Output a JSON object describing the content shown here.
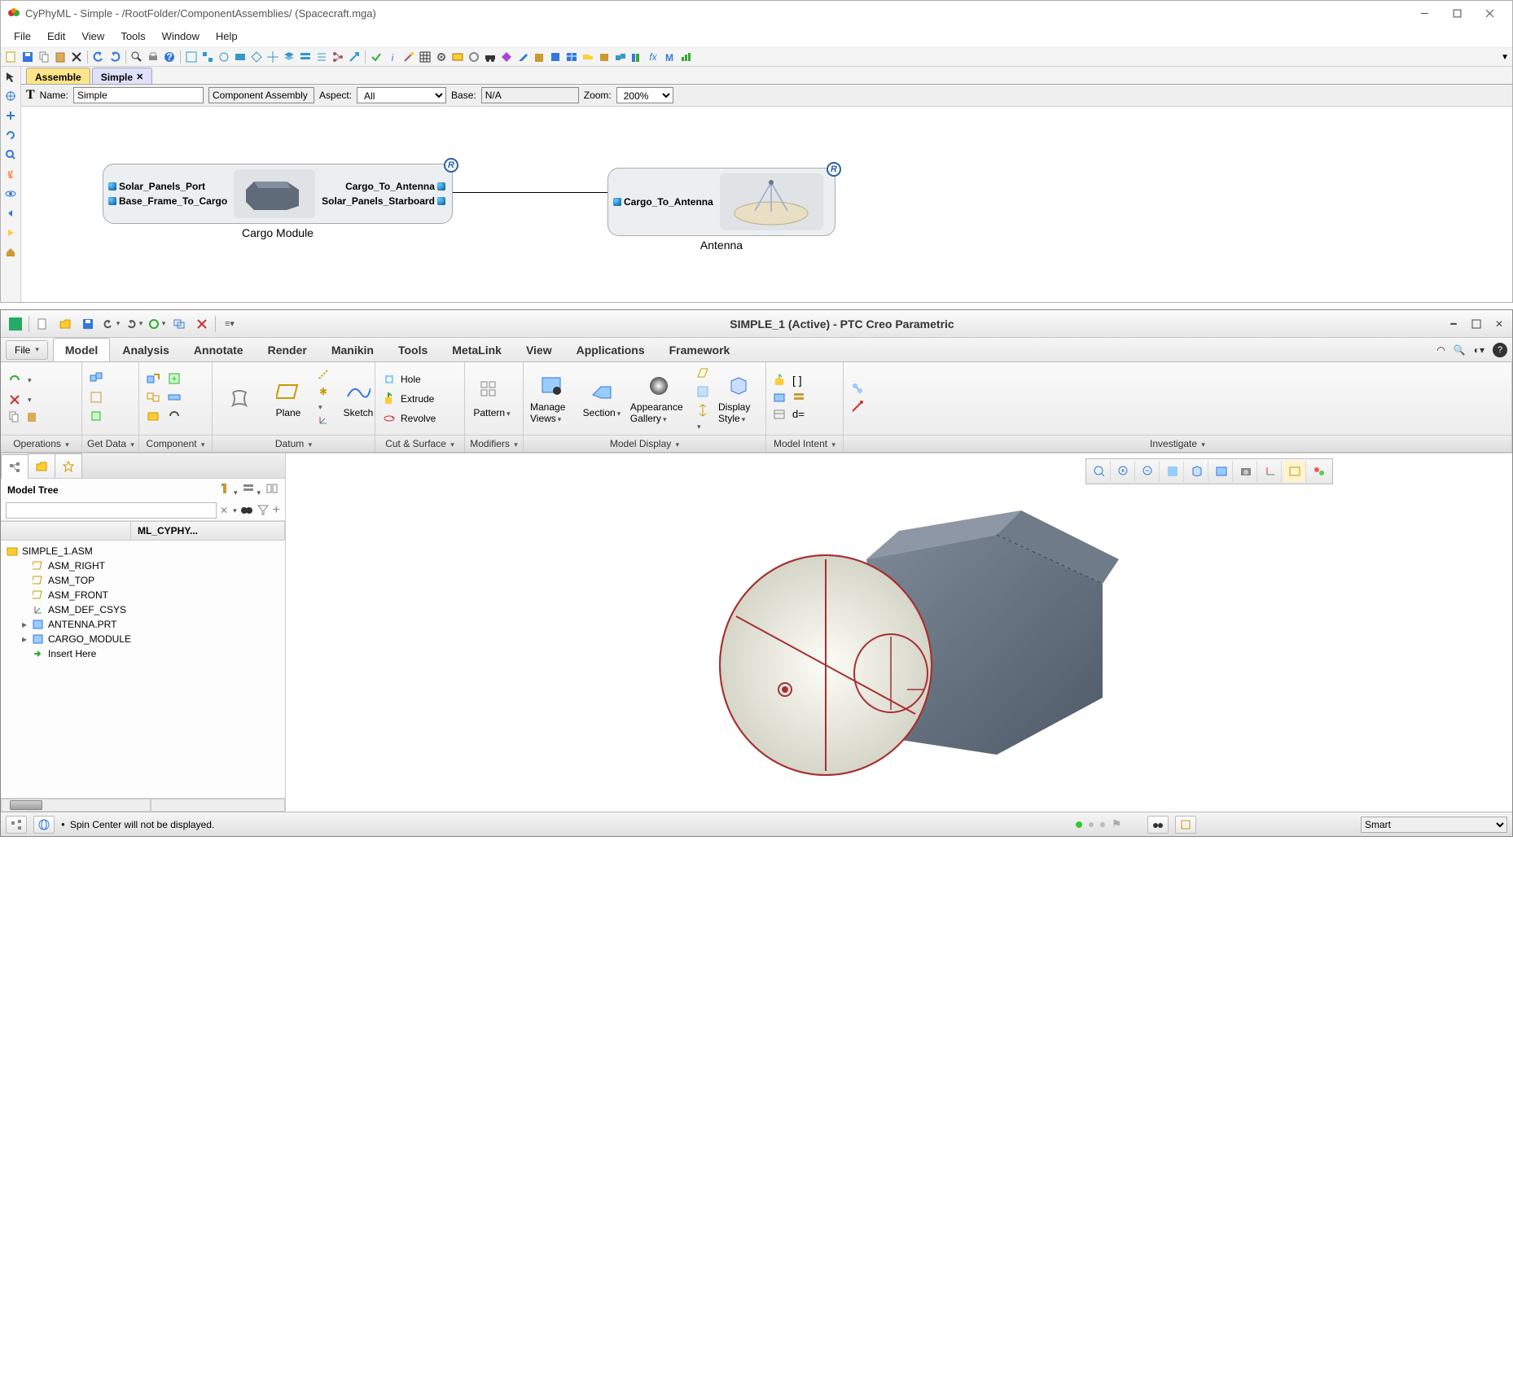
{
  "gme": {
    "title": "CyPhyML - Simple - /RootFolder/ComponentAssemblies/ (Spacecraft.mga)",
    "menu": [
      "File",
      "Edit",
      "View",
      "Tools",
      "Window",
      "Help"
    ],
    "tabs": {
      "background": "Assemble",
      "active": "Simple"
    },
    "props": {
      "name_label": "Name:",
      "name_value": "Simple",
      "type": "Component Assembly",
      "aspect_label": "Aspect:",
      "aspect_value": "All",
      "base_label": "Base:",
      "base_value": "N/A",
      "zoom_label": "Zoom:",
      "zoom_value": "200%"
    },
    "nodes": {
      "cargo": {
        "label": "Cargo Module",
        "ports_left": [
          "Solar_Panels_Port",
          "Base_Frame_To_Cargo"
        ],
        "ports_right": [
          "Cargo_To_Antenna",
          "Solar_Panels_Starboard"
        ]
      },
      "antenna": {
        "label": "Antenna",
        "ports_left": [
          "Cargo_To_Antenna"
        ]
      },
      "badge": "R"
    }
  },
  "creo": {
    "title": "SIMPLE_1 (Active) - PTC Creo Parametric",
    "file_label": "File",
    "tabs": [
      "Model",
      "Analysis",
      "Annotate",
      "Render",
      "Manikin",
      "Tools",
      "MetaLink",
      "View",
      "Applications",
      "Framework"
    ],
    "active_tab": "Model",
    "ribbon": {
      "operations": "Operations",
      "getdata": "Get Data",
      "component": "Component",
      "datum": "Datum",
      "plane": "Plane",
      "sketch": "Sketch",
      "cutsurface": "Cut & Surface",
      "hole": "Hole",
      "extrude": "Extrude",
      "revolve": "Revolve",
      "modifiers": "Modifiers",
      "pattern": "Pattern",
      "modeldisplay": "Model Display",
      "manageviews": "Manage Views",
      "section": "Section",
      "appearance": "Appearance Gallery",
      "displaystyle": "Display Style",
      "modelintent": "Model Intent",
      "investigate": "Investigate",
      "brackets": "[ ]",
      "de": "d="
    },
    "tree": {
      "header": "Model Tree",
      "col2": "ML_CYPHY...",
      "root": "SIMPLE_1.ASM",
      "items": [
        "ASM_RIGHT",
        "ASM_TOP",
        "ASM_FRONT",
        "ASM_DEF_CSYS",
        "ANTENNA.PRT",
        "CARGO_MODULE",
        "Insert Here"
      ]
    },
    "status": {
      "msg": "Spin Center will not be displayed.",
      "sel_filter": "Smart"
    }
  }
}
